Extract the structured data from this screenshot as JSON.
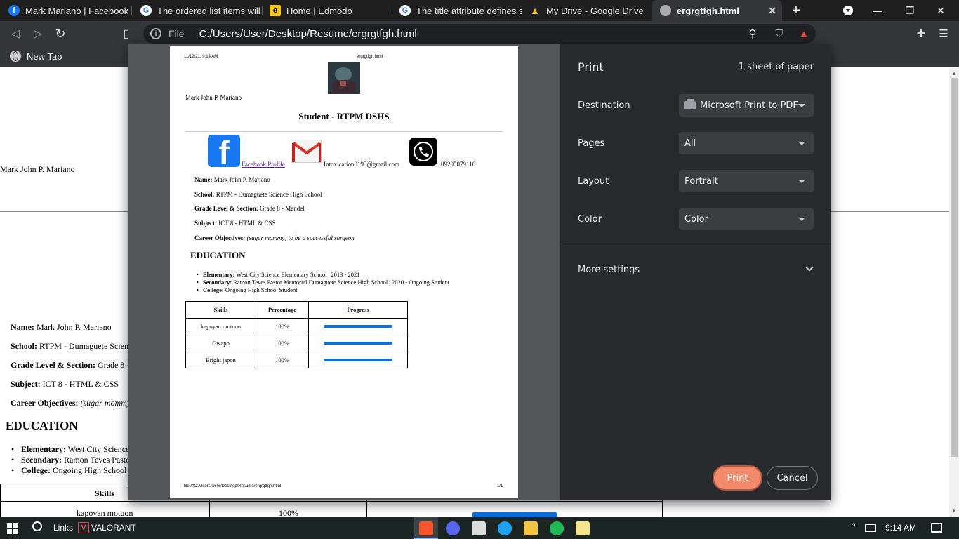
{
  "tabs": [
    {
      "label": "Mark Mariano | Facebook",
      "icon": "facebook-icon",
      "color": "#1877f2",
      "glyph": "f"
    },
    {
      "label": "The ordered list items will b",
      "icon": "google-icon",
      "color": "#ffffff",
      "glyph": "G"
    },
    {
      "label": "Home | Edmodo",
      "icon": "edmodo-icon",
      "color": "#f5c518",
      "glyph": "e"
    },
    {
      "label": "The title attribute defines so",
      "icon": "google-icon",
      "color": "#ffffff",
      "glyph": "G"
    },
    {
      "label": "My Drive - Google Drive",
      "icon": "google-drive-icon",
      "color": "#34a853",
      "glyph": "▲"
    },
    {
      "label": "ergrgtfgh.html",
      "icon": "globe-icon",
      "color": "#aaaaaa",
      "glyph": ""
    }
  ],
  "address_bar": {
    "scheme": "File",
    "url": "C:/Users/User/Desktop/Resume/ergrgtfgh.html"
  },
  "bookmarks": {
    "new_tab": "New Tab"
  },
  "background_page": {
    "name": "Mark John P. Mariano",
    "fields": [
      {
        "label": "Name:",
        "value": "Mark John P. Mariano"
      },
      {
        "label": "School:",
        "value": "RTPM - Dumaguete Scien"
      },
      {
        "label": "Grade Level & Section:",
        "value": "Grade 8 -"
      },
      {
        "label": "Subject:",
        "value": "ICT 8 - HTML & CSS"
      },
      {
        "label": "Career Objectives:",
        "value": "(sugar mommy"
      }
    ],
    "education_heading": "EDUCATION",
    "education": [
      {
        "label": "Elementary:",
        "value": "West City Science"
      },
      {
        "label": "Secondary:",
        "value": "Ramon Teves Pasto"
      },
      {
        "label": "College:",
        "value": "Ongoing High School"
      }
    ],
    "table_header_skills": "Skills",
    "table_first_skill": "kapoyan motuon",
    "table_first_pct": "100%"
  },
  "print_preview": {
    "header_date": "11/12/21, 9:14 AM",
    "header_title": "ergrgtfgh.html",
    "name": "Mark John P. Mariano",
    "title": "Student - RTPM DSHS",
    "facebook_link": "Facebook Profile",
    "email": "Intoxication0193@gmail.com",
    "phone": "09205079116.",
    "fields": [
      {
        "label": "Name:",
        "value": "Mark John P. Mariano",
        "italic": false
      },
      {
        "label": "School:",
        "value": "RTPM - Dumaguete Science High School",
        "italic": false
      },
      {
        "label": "Grade Level & Section:",
        "value": "Grade 8 - Mendel",
        "italic": false
      },
      {
        "label": "Subject:",
        "value": "ICT 8 - HTML & CSS",
        "italic": false
      },
      {
        "label": "Career Objectives:",
        "value": "(sugar mommy) to be a successful surgeon",
        "italic": true
      }
    ],
    "education_heading": "EDUCATION",
    "education": [
      {
        "label": "Elementary:",
        "value": "West City Science Elementary School | 2013 - 2021"
      },
      {
        "label": "Secondary:",
        "value": "Ramon Teves Pastor Memorial Dumaguete Science High School | 2020 - Ongoing Student"
      },
      {
        "label": "College:",
        "value": "Ongoing High School Student"
      }
    ],
    "table": {
      "headers": [
        "Skills",
        "Percentage",
        "Progress"
      ],
      "rows": [
        {
          "skill": "kapoyan motuon",
          "percentage": "100%",
          "progress": 1.0
        },
        {
          "skill": "Gwapo",
          "percentage": "100%",
          "progress": 1.0
        },
        {
          "skill": "Bright japon",
          "percentage": "100%",
          "progress": 1.0
        }
      ]
    },
    "footer_path": "file:///C:/Users/User/Desktop/Resume/ergrgtfgh.html",
    "footer_page": "1/1"
  },
  "print_settings": {
    "title": "Print",
    "sheets": "1 sheet of paper",
    "destination_label": "Destination",
    "destination_value": "Microsoft Print to PDF",
    "pages_label": "Pages",
    "pages_value": "All",
    "layout_label": "Layout",
    "layout_value": "Portrait",
    "color_label": "Color",
    "color_value": "Color",
    "more_settings": "More settings",
    "print_button": "Print",
    "cancel_button": "Cancel"
  },
  "taskbar": {
    "links": "Links",
    "valorant": "VALORANT",
    "time": "9:14 AM"
  },
  "colors": {
    "accent_print": "#f28b6b",
    "progress_bar": "#0a6fe0",
    "facebook": "#1877f2"
  }
}
